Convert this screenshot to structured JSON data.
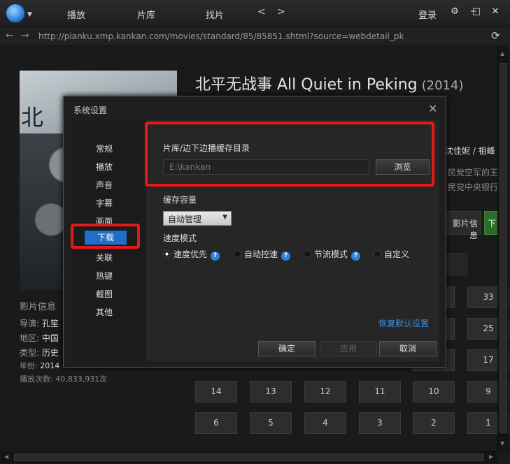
{
  "topbar": {
    "nav": [
      "播放",
      "片库",
      "找片"
    ],
    "nav_arrows": "< >",
    "login": "登录",
    "window_controls": [
      "⚙",
      "−",
      "□",
      "✕"
    ]
  },
  "addressbar": {
    "url": "http://pianku.xmp.kankan.com/movies/standard/85/85851.shtml?source=webdetail_pk",
    "refresh_icon": "refresh-icon"
  },
  "movie": {
    "poster_text": "北",
    "title": "北平无战事 All Quiet in Peking",
    "year": "(2014)",
    "cast_snippet": "沈佳妮 / 祖峰",
    "desc_lines": [
      "民党空军的王",
      "民党中央银行"
    ],
    "info_button": "影片信息",
    "green_button": "下"
  },
  "info": {
    "heading": "影片信息",
    "director_label": "导演:",
    "director": "孔笙",
    "region_label": "地区:",
    "region": "中国",
    "genre_label": "类型:",
    "genre": "历史",
    "year_label": "年份:",
    "year": "2014",
    "playcount": "播放次数: 40,833,931次"
  },
  "episodes": {
    "row1": [
      "",
      "",
      "",
      "33"
    ],
    "row2": [
      "",
      "25"
    ],
    "row3": [
      "",
      "17"
    ],
    "row4": [
      "14",
      "13",
      "12",
      "11",
      "10",
      "9"
    ],
    "row5": [
      "6",
      "5",
      "4",
      "3",
      "2",
      "1"
    ]
  },
  "dialog": {
    "title": "系统设置",
    "close": "✕",
    "sidebar": [
      "常规",
      "播放",
      "声音",
      "字幕",
      "画面",
      "下载",
      "关联",
      "热键",
      "截图",
      "其他"
    ],
    "active": "下载",
    "cache_dir_label": "片库/边下边播缓存目录",
    "cache_dir_value": "E:\\kankan",
    "browse": "浏览",
    "cache_capacity_label": "缓存容量",
    "cache_capacity_value": "自动管理",
    "speed_mode_label": "速度模式",
    "speed_modes": [
      "速度优先",
      "自动控速",
      "节流模式",
      "自定义"
    ],
    "selected_speed_mode": "速度优先",
    "restore_defaults": "恢复默认设置",
    "ok": "确定",
    "apply": "应用",
    "cancel": "取消"
  },
  "colors": {
    "accent": "#1f6fc9",
    "highlight": "#e51919",
    "link": "#3d8ee8"
  }
}
